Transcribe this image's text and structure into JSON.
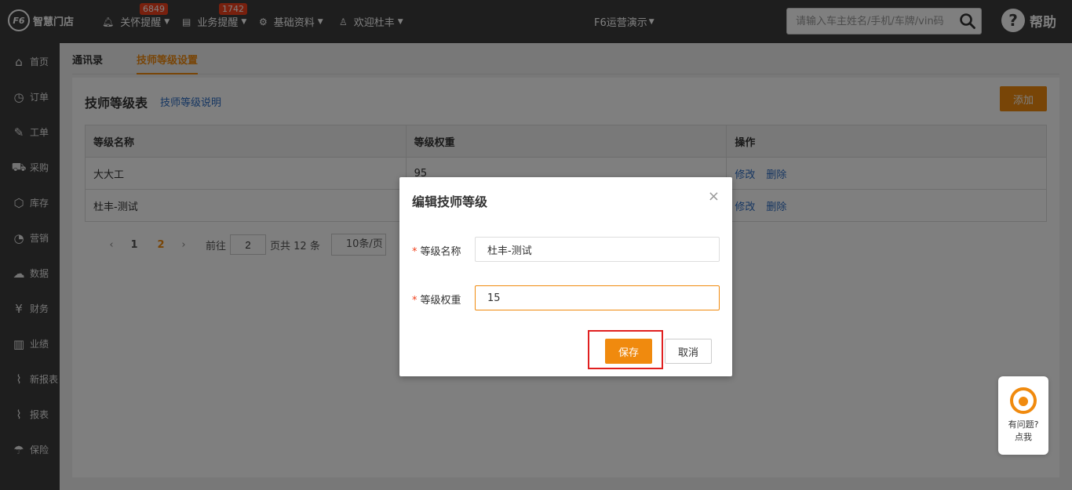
{
  "topbar": {
    "logo_mark": "F6",
    "logo_text": "智慧门店",
    "care": {
      "label": "关怀提醒",
      "badge": "6849"
    },
    "business": {
      "label": "业务提醒",
      "badge": "1742"
    },
    "basic": {
      "label": "基础资料"
    },
    "user": {
      "label": "欢迎杜丰"
    },
    "org": "F6运营演示",
    "search_placeholder": "请输入车主姓名/手机/车牌/vin码",
    "help": "帮助"
  },
  "sidebar": {
    "items": [
      {
        "label": "首页",
        "icon": "⌂"
      },
      {
        "label": "订单",
        "icon": "◷"
      },
      {
        "label": "工单",
        "icon": "✎"
      },
      {
        "label": "采购",
        "icon": "⛟"
      },
      {
        "label": "库存",
        "icon": "⬡"
      },
      {
        "label": "营销",
        "icon": "◔"
      },
      {
        "label": "数据",
        "icon": "☁"
      },
      {
        "label": "财务",
        "icon": "¥"
      },
      {
        "label": "业绩",
        "icon": "▥"
      },
      {
        "label": "新报表",
        "icon": "⌇"
      },
      {
        "label": "报表",
        "icon": "⌇"
      },
      {
        "label": "保险",
        "icon": "☂"
      }
    ]
  },
  "tabs": [
    "通讯录",
    "技师等级设置"
  ],
  "card": {
    "title": "技师等级表",
    "link": "技师等级说明",
    "add_button": "添加"
  },
  "table": {
    "headers": [
      "等级名称",
      "等级权重",
      "操作"
    ],
    "rows": [
      {
        "name": "大大工",
        "weight": "95"
      },
      {
        "name": "杜丰-测试",
        "weight": ""
      }
    ],
    "edit": "修改",
    "delete": "删除"
  },
  "pager": {
    "prev": "‹",
    "next": "›",
    "pages": [
      "1",
      "2"
    ],
    "goto_prefix": "前往",
    "goto_value": "2",
    "goto_suffix": "页共 12 条",
    "page_size": "10条/页"
  },
  "modal": {
    "title": "编辑技师等级",
    "close": "×",
    "required_mark": "*",
    "name_label": "等级名称",
    "name_value": "杜丰-测试",
    "weight_label": "等级权重",
    "weight_value": "15",
    "save": "保存",
    "cancel": "取消"
  },
  "helper": {
    "line1": "有问题?",
    "line2": "点我"
  }
}
